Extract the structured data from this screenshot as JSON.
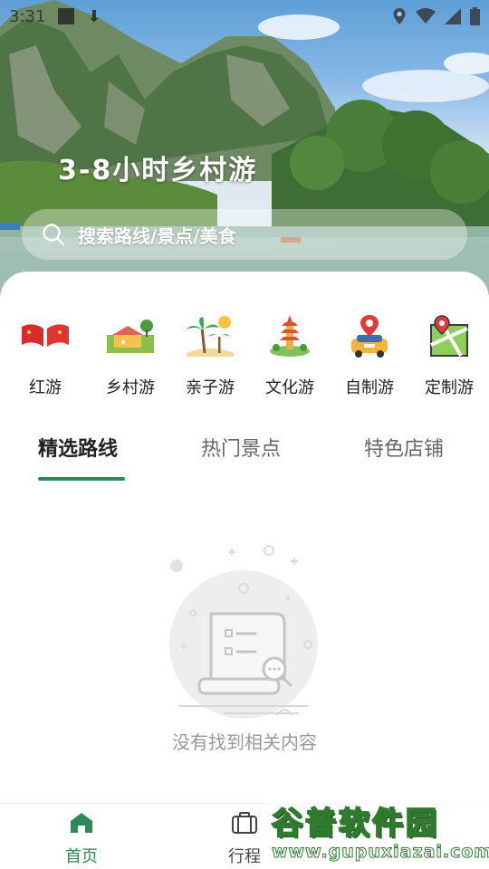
{
  "status_bar": {
    "time": "3:31"
  },
  "hero": {
    "title": "3-8小时乡村游"
  },
  "search": {
    "placeholder": "搜索路线/景点/美食"
  },
  "categories": [
    {
      "label": "红游",
      "icon": "red-flag-icon"
    },
    {
      "label": "乡村游",
      "icon": "farm-icon"
    },
    {
      "label": "亲子游",
      "icon": "palm-beach-icon"
    },
    {
      "label": "文化游",
      "icon": "pagoda-icon"
    },
    {
      "label": "自制游",
      "icon": "car-location-icon"
    },
    {
      "label": "定制游",
      "icon": "map-pin-icon"
    }
  ],
  "tabs": [
    {
      "label": "精选路线",
      "active": true
    },
    {
      "label": "热门景点",
      "active": false
    },
    {
      "label": "特色店铺",
      "active": false
    }
  ],
  "empty_state": {
    "text": "没有找到相关内容",
    "icon": "empty-document-search-icon"
  },
  "bottom_nav": [
    {
      "label": "首页",
      "icon": "home-icon",
      "active": true
    },
    {
      "label": "行程",
      "icon": "briefcase-icon",
      "active": false
    }
  ],
  "watermark": {
    "brand": "谷普软件园",
    "url": "www.gupuxiazai.com"
  },
  "colors": {
    "accent": "#2d8a57",
    "text": "#222222",
    "muted": "#999999"
  }
}
